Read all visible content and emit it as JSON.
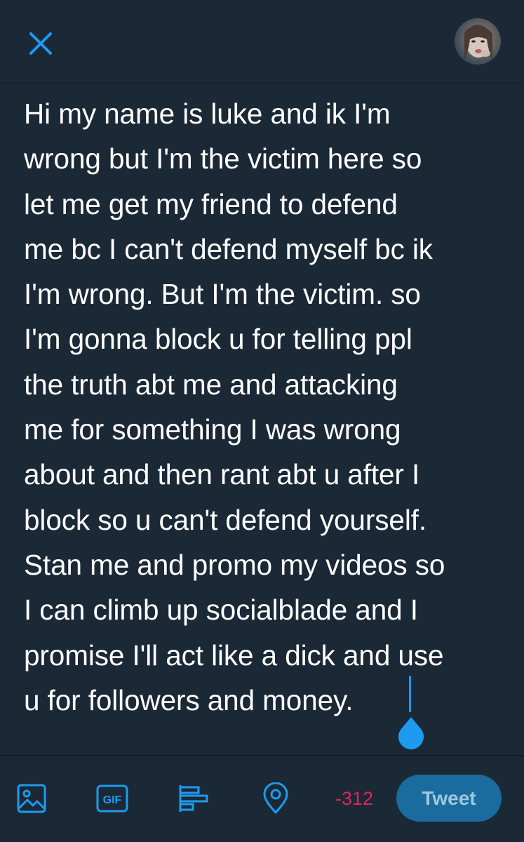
{
  "header": {
    "close_icon": "close-icon",
    "avatar_icon": "profile-avatar"
  },
  "compose": {
    "text": "Hi my name is luke and ik I'm\nwrong but I'm the victim here so\nlet me get my friend to defend\nme bc I can't defend myself bc ik\nI'm wrong. But I'm the victim. so\nI'm gonna block u for telling ppl\nthe truth abt me and attacking\nme for something I was wrong\nabout and then rant abt u after I\nblock so u can't defend yourself.\nStan me and promo my videos so\nI can climb up socialblade and I\npromise I'll act like a dick and use\nu for followers and money."
  },
  "toolbar": {
    "media_icon": "image-icon",
    "gif_label": "GIF",
    "poll_icon": "poll-icon",
    "location_icon": "location-icon",
    "char_count": "-312",
    "tweet_label": "Tweet"
  },
  "colors": {
    "background": "#1b2836",
    "accent": "#1d9bf0",
    "counter_over_limit": "#e0245e",
    "tweet_button_disabled": "#1a6b9e"
  }
}
